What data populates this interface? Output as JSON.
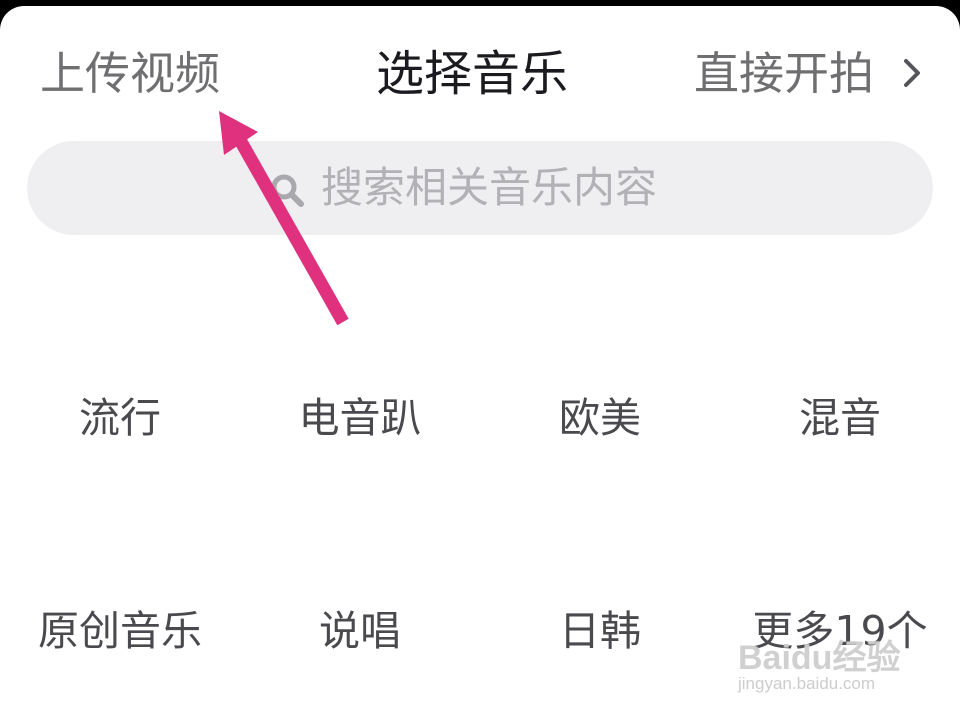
{
  "header": {
    "upload_label": "上传视频",
    "title": "选择音乐",
    "shoot_label": "直接开拍"
  },
  "search": {
    "placeholder": "搜索相关音乐内容"
  },
  "categories": [
    {
      "label": "流行"
    },
    {
      "label": "电音趴"
    },
    {
      "label": "欧美"
    },
    {
      "label": "混音"
    },
    {
      "label": "原创音乐"
    },
    {
      "label": "说唱"
    },
    {
      "label": "日韩"
    },
    {
      "label": "更多19个"
    }
  ],
  "icons": {
    "search": "search-icon",
    "chevron": "chevron-right-icon",
    "annotation": "annotation-arrow-icon"
  },
  "colors": {
    "annotation_arrow": "#e0317e",
    "search_background": "#efeff1",
    "title_text": "#1a1a1f",
    "secondary_text": "#6f6f72"
  },
  "watermark": {
    "logo": "Baidu经验",
    "url": "jingyan.baidu.com"
  }
}
